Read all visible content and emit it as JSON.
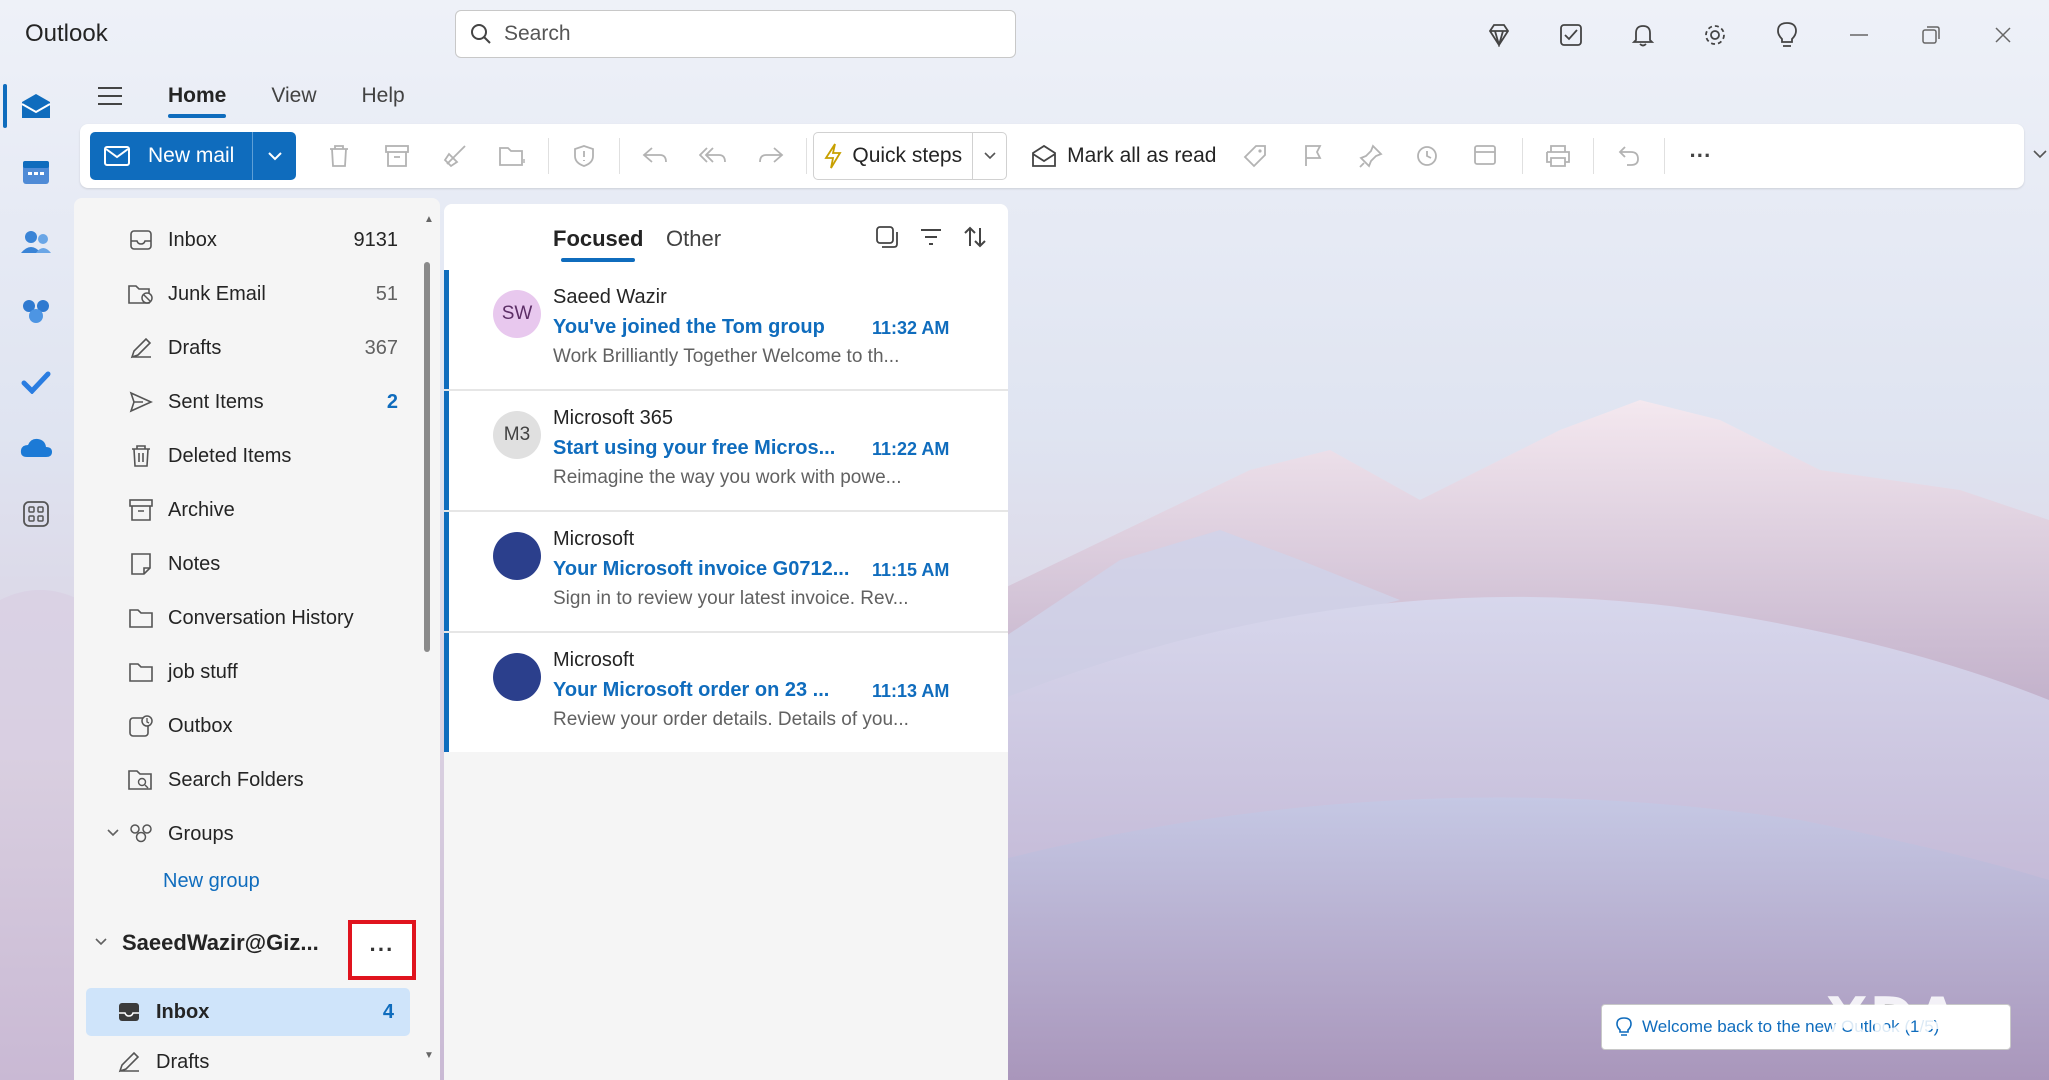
{
  "app": {
    "title": "Outlook"
  },
  "search": {
    "placeholder": "Search"
  },
  "menu": {
    "tabs": [
      "Home",
      "View",
      "Help"
    ],
    "active": "Home"
  },
  "ribbon": {
    "new_mail_label": "New mail",
    "quick_steps_label": "Quick steps",
    "mark_all_read_label": "Mark all as read",
    "more_label": "···"
  },
  "folders": {
    "items": [
      {
        "name": "Inbox",
        "count": "9131",
        "icon": "inbox-icon"
      },
      {
        "name": "Junk Email",
        "count": "51",
        "icon": "junk-icon"
      },
      {
        "name": "Drafts",
        "count": "367",
        "icon": "drafts-icon"
      },
      {
        "name": "Sent Items",
        "count": "2",
        "icon": "send-icon"
      },
      {
        "name": "Deleted Items",
        "count": "",
        "icon": "trash-icon"
      },
      {
        "name": "Archive",
        "count": "",
        "icon": "archive-icon"
      },
      {
        "name": "Notes",
        "count": "",
        "icon": "notes-icon"
      },
      {
        "name": "Conversation History",
        "count": "",
        "icon": "folder-icon"
      },
      {
        "name": "job stuff",
        "count": "",
        "icon": "folder-icon"
      },
      {
        "name": "Outbox",
        "count": "",
        "icon": "outbox-icon"
      },
      {
        "name": "Search Folders",
        "count": "",
        "icon": "search-folder-icon"
      }
    ],
    "groups_label": "Groups",
    "new_group_label": "New group",
    "account_name": "SaeedWazir@Giz...",
    "account_more": "···",
    "account_inbox": {
      "name": "Inbox",
      "count": "4"
    },
    "account_drafts": {
      "name": "Drafts"
    }
  },
  "message_list": {
    "tabs": {
      "focused": "Focused",
      "other": "Other"
    },
    "messages": [
      {
        "initials": "SW",
        "avatar_color": "#e8c8ee",
        "avatar_text_color": "#5c2e66",
        "sender": "Saeed Wazir",
        "subject": "You've joined the Tom group",
        "time": "11:32 AM",
        "preview": "Work Brilliantly Together Welcome to th..."
      },
      {
        "initials": "M3",
        "avatar_color": "#e0e0e0",
        "avatar_text_color": "#424242",
        "sender": "Microsoft 365",
        "subject": "Start using your free Micros...",
        "time": "11:22 AM",
        "preview": "Reimagine the way you work with powe..."
      },
      {
        "initials": "",
        "avatar_color": "#2b3f8c",
        "avatar_text_color": "#ffffff",
        "sender": "Microsoft",
        "subject": "Your Microsoft invoice G0712...",
        "time": "11:15 AM",
        "preview": "Sign in to review your latest invoice. Rev..."
      },
      {
        "initials": "",
        "avatar_color": "#2b3f8c",
        "avatar_text_color": "#ffffff",
        "sender": "Microsoft",
        "subject": "Your Microsoft order on 23 ...",
        "time": "11:13 AM",
        "preview": "Review your order details. Details of you..."
      }
    ]
  },
  "toast": {
    "text": "Welcome back to the new Outlook (1/5)"
  },
  "watermark": {
    "text": "XDA"
  },
  "colors": {
    "accent": "#0f6cbd",
    "highlight": "#e0141e"
  }
}
